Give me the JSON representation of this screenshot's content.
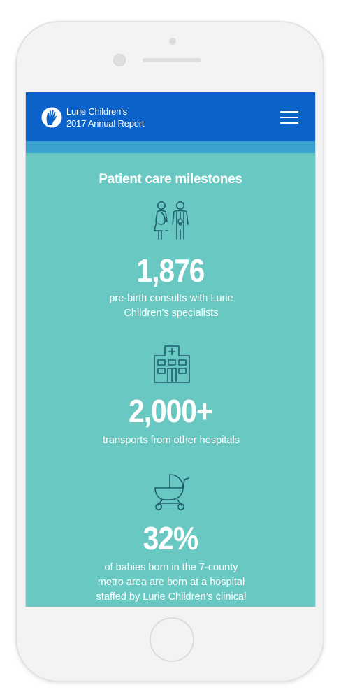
{
  "header": {
    "brand_line1": "Lurie Children’s",
    "brand_line2": "2017 Annual Report",
    "logo_icon": "hand-logo-icon",
    "menu_icon": "hamburger-menu-icon"
  },
  "section": {
    "title": "Patient care milestones"
  },
  "milestones": [
    {
      "icon": "parents-icon",
      "value": "1,876",
      "desc_line1": "pre-birth consults with Lurie",
      "desc_line2": "Children’s specialists"
    },
    {
      "icon": "hospital-icon",
      "value": "2,000+",
      "desc_line1": "transports from other hospitals"
    },
    {
      "icon": "stroller-icon",
      "value": "32%",
      "desc_line1": "of babies born in the 7-county",
      "desc_line2": "metro area are born at a hospital",
      "desc_line3": "staffed by Lurie Children’s clinical"
    }
  ],
  "colors": {
    "header_bg": "#0b62c9",
    "subbar_bg": "#3aa2cf",
    "content_bg": "#69c8c1",
    "icon_stroke": "#1f5f6e",
    "text": "#ffffff"
  }
}
